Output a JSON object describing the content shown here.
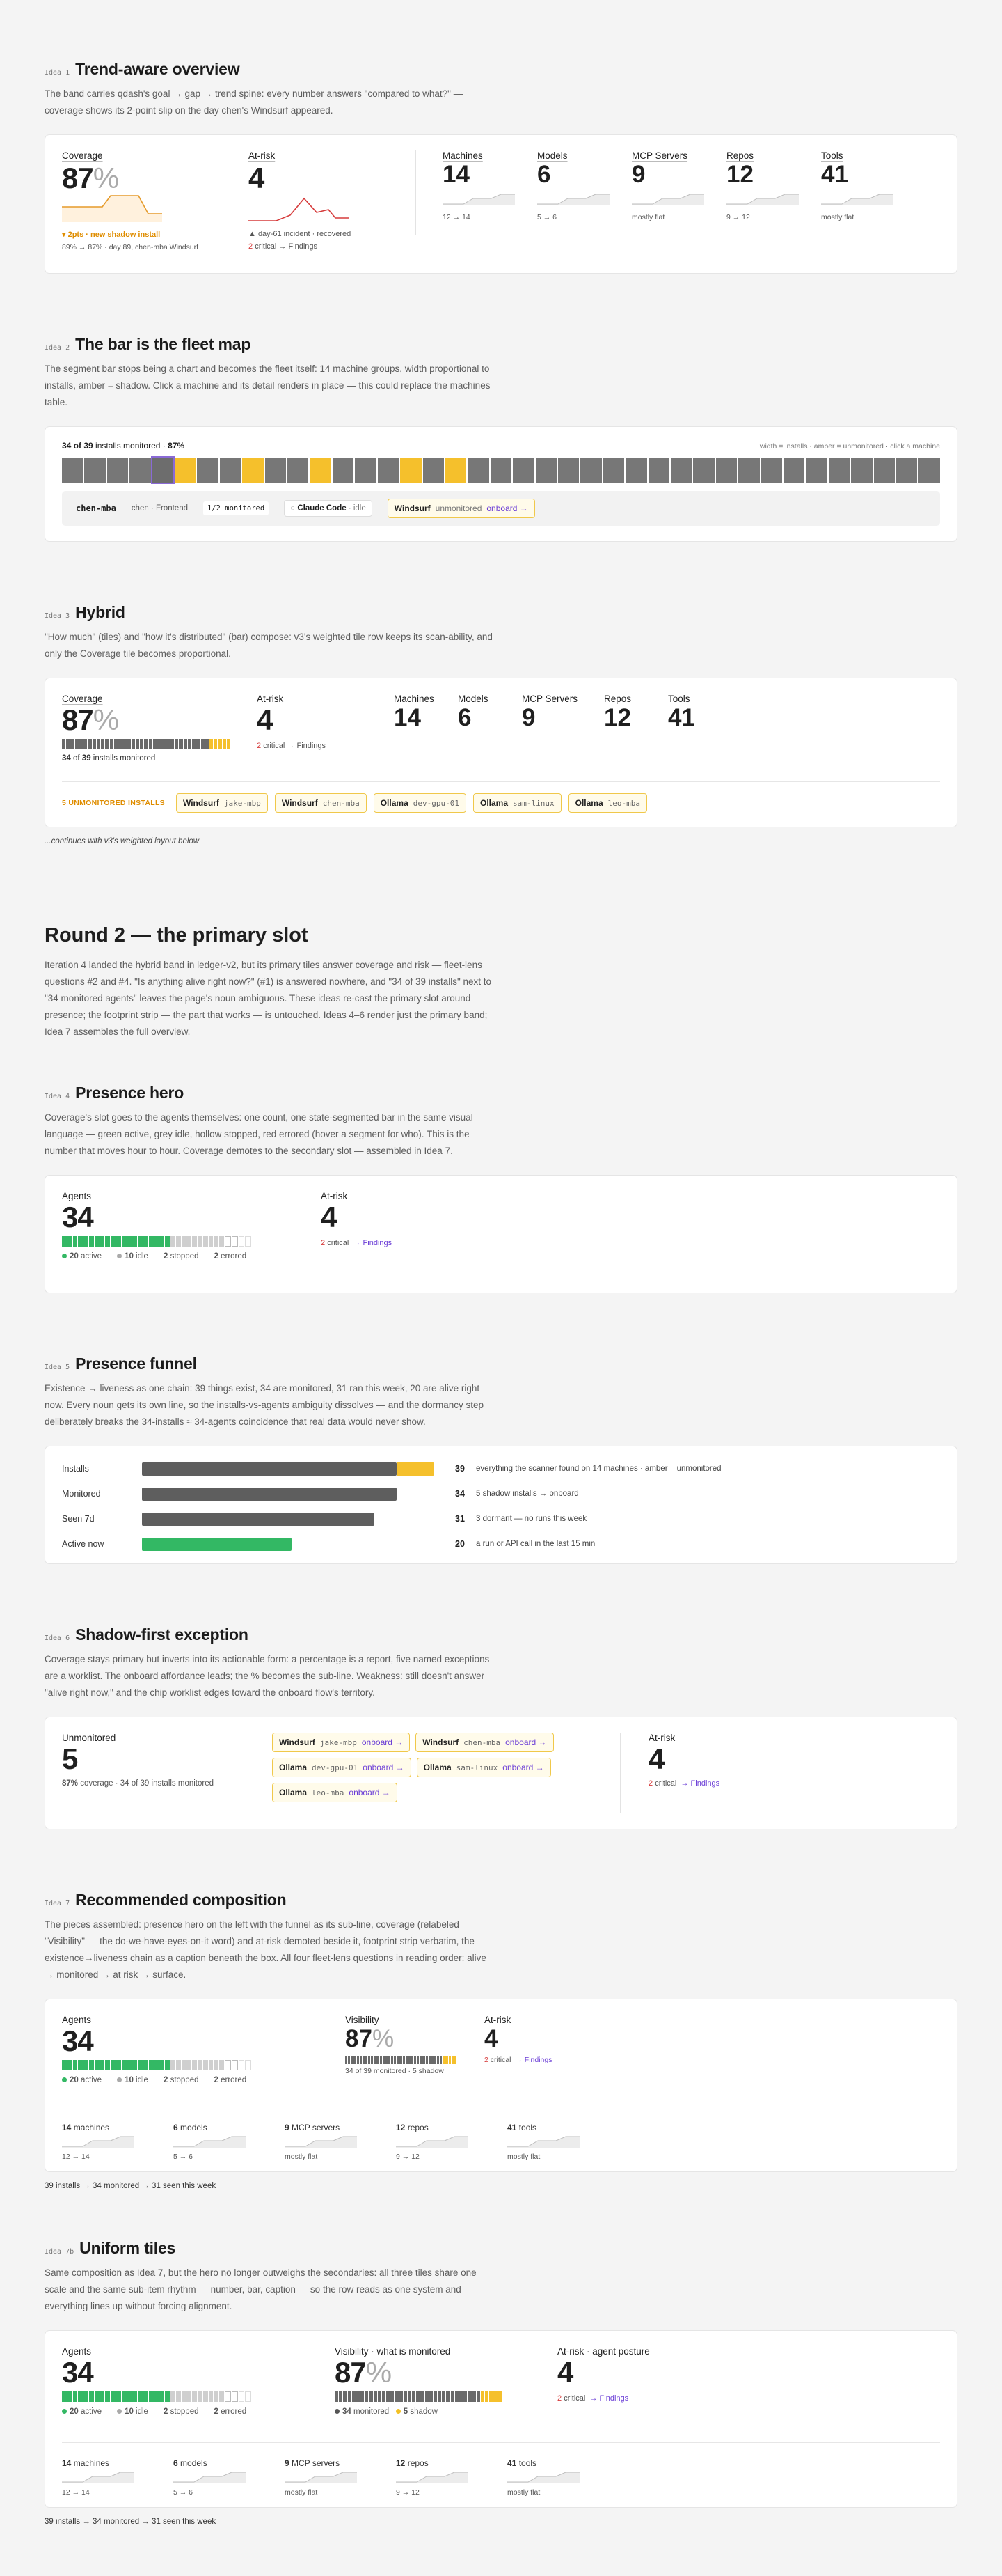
{
  "idea1": {
    "tag": "Idea 1",
    "title": "Trend-aware overview",
    "desc": "The band carries qdash's goal → gap → trend spine: every number answers \"compared to what?\" — coverage shows its 2-point slip on the day chen's Windsurf appeared.",
    "coverage": {
      "label": "Coverage",
      "value": "87",
      "pct": "%",
      "note": "▾ 2pts · new shadow install",
      "sub": "89% → 87% · day 89, chen-mba Windsurf",
      "series": [
        89,
        89,
        89,
        89,
        89,
        89,
        89,
        87,
        87
      ]
    },
    "atrisk": {
      "label": "At-risk",
      "value": "4",
      "note": "▲ day-61 incident · recovered",
      "sub_count": "2",
      "sub_text": "critical → Findings",
      "series": [
        1,
        1,
        1,
        1,
        4,
        3,
        2,
        1,
        1,
        1,
        2
      ]
    },
    "tiles": [
      {
        "label": "Machines",
        "value": "14",
        "sub": "12 → 14"
      },
      {
        "label": "Models",
        "value": "6",
        "sub": "5 → 6"
      },
      {
        "label": "MCP Servers",
        "value": "9",
        "sub": "mostly flat"
      },
      {
        "label": "Repos",
        "value": "12",
        "sub": "9 → 12"
      },
      {
        "label": "Tools",
        "value": "41",
        "sub": "mostly flat"
      }
    ]
  },
  "idea2": {
    "tag": "Idea 2",
    "title": "The bar is the fleet map",
    "desc": "The segment bar stops being a chart and becomes the fleet itself: 14 machine groups, width proportional to installs, amber = shadow. Click a machine and its detail renders in place — this could replace the machines table.",
    "count_bold": "34 of 39",
    "count_rest": "installs monitored ·",
    "count_pct": "87%",
    "hint": "width = installs · amber = unmonitored · click a machine",
    "detail": {
      "machine": "chen-mba",
      "owner": "chen · Frontend",
      "monitored": "1/2 monitored",
      "tool1": "Claude Code",
      "tool1_state": "· idle",
      "tool2": "Windsurf",
      "tool2_state": "unmonitored",
      "onboard": "onboard →"
    },
    "segments": [
      "g",
      "g",
      "g",
      "g",
      "sel",
      "a",
      "g",
      "g",
      "a",
      "g",
      "g",
      "a",
      "g",
      "g",
      "g",
      "a",
      "g",
      "a",
      "g",
      "g",
      "g",
      "g",
      "g",
      "g",
      "g",
      "g",
      "g",
      "g",
      "g",
      "g",
      "g",
      "g",
      "g",
      "g",
      "g",
      "g",
      "g",
      "g",
      "g"
    ]
  },
  "idea3": {
    "tag": "Idea 3",
    "title": "Hybrid",
    "desc": "\"How much\" (tiles) and \"how it's distributed\" (bar) compose: v3's weighted tile row keeps its scan-ability, and only the Coverage tile becomes proportional.",
    "coverage": {
      "label": "Coverage",
      "value": "87",
      "pct": "%",
      "sub_bold": "34",
      "sub_rest": "of",
      "sub_bold2": "39",
      "sub_tail": "installs monitored",
      "segments": [
        "g",
        "g",
        "g",
        "g",
        "g",
        "g",
        "g",
        "g",
        "g",
        "g",
        "g",
        "g",
        "g",
        "g",
        "g",
        "g",
        "g",
        "g",
        "g",
        "g",
        "g",
        "g",
        "g",
        "g",
        "g",
        "g",
        "g",
        "g",
        "g",
        "g",
        "g",
        "g",
        "g",
        "g",
        "a",
        "a",
        "a",
        "a",
        "a"
      ]
    },
    "atrisk": {
      "label": "At-risk",
      "value": "4",
      "sub_count": "2",
      "sub_text": "critical → Findings"
    },
    "tiles": [
      {
        "label": "Machines",
        "value": "14"
      },
      {
        "label": "Models",
        "value": "6"
      },
      {
        "label": "MCP Servers",
        "value": "9"
      },
      {
        "label": "Repos",
        "value": "12"
      },
      {
        "label": "Tools",
        "value": "41"
      }
    ],
    "unmon_label": "5 UNMONITORED INSTALLS",
    "chips": [
      {
        "tool": "Windsurf",
        "host": "jake-mbp"
      },
      {
        "tool": "Windsurf",
        "host": "chen-mba"
      },
      {
        "tool": "Ollama",
        "host": "dev-gpu-01"
      },
      {
        "tool": "Ollama",
        "host": "sam-linux"
      },
      {
        "tool": "Ollama",
        "host": "leo-mba"
      }
    ],
    "continues": "...continues with v3's weighted layout below"
  },
  "round2": {
    "title": "Round 2 — the primary slot",
    "desc": "Iteration 4 landed the hybrid band in ledger-v2, but its primary tiles answer coverage and risk — fleet-lens questions #2 and #4. \"Is anything alive right now?\" (#1) is answered nowhere, and \"34 of 39 installs\" next to \"34 monitored agents\" leaves the page's noun ambiguous. These ideas re-cast the primary slot around presence; the footprint strip — the part that works — is untouched. Ideas 4–6 render just the primary band; Idea 7 assembles the full overview."
  },
  "idea4": {
    "tag": "Idea 4",
    "title": "Presence hero",
    "desc": "Coverage's slot goes to the agents themselves: one count, one state-segmented bar in the same visual language — green active, grey idle, hollow stopped, red errored (hover a segment for who). This is the number that moves hour to hour. Coverage demotes to the secondary slot — assembled in Idea 7.",
    "agents": {
      "label": "Agents",
      "value": "34",
      "active": "20",
      "active_l": "active",
      "idle": "10",
      "idle_l": "idle",
      "stopped": "2",
      "stopped_l": "stopped",
      "errored": "2",
      "errored_l": "errored"
    },
    "atrisk": {
      "label": "At-risk",
      "value": "4",
      "sub_count": "2",
      "sub_text": "critical",
      "link": "→ Findings"
    }
  },
  "idea5": {
    "tag": "Idea 5",
    "title": "Presence funnel",
    "desc": "Existence → liveness as one chain: 39 things exist, 34 are monitored, 31 ran this week, 20 are alive right now. Every noun gets its own line, so the installs-vs-agents ambiguity dissolves — and the dormancy step deliberately breaks the 34-installs ≈ 34-agents coincidence that real data would never show.",
    "rows": [
      {
        "label": "Installs",
        "value": "39",
        "note": "everything the scanner found on 14 machines · amber = unmonitored",
        "n": 39,
        "shadow": 5,
        "color": "#5e5e5e"
      },
      {
        "label": "Monitored",
        "value": "34",
        "note": "5 shadow installs → onboard",
        "n": 34,
        "shadow": 0,
        "color": "#5e5e5e"
      },
      {
        "label": "Seen 7d",
        "value": "31",
        "note": "3 dormant — no runs this week",
        "n": 31,
        "shadow": 0,
        "color": "#5e5e5e"
      },
      {
        "label": "Active now",
        "value": "20",
        "note": "a run or API call in the last 15 min",
        "n": 20,
        "shadow": 0,
        "color": "#33b864"
      }
    ]
  },
  "idea6": {
    "tag": "Idea 6",
    "title": "Shadow-first exception",
    "desc": "Coverage stays primary but inverts into its actionable form: a percentage is a report, five named exceptions are a worklist. The onboard affordance leads; the % becomes the sub-line. Weakness: still doesn't answer \"alive right now,\" and the chip worklist edges toward the onboard flow's territory.",
    "unmon": {
      "label": "Unmonitored",
      "value": "5",
      "sub_bold": "87%",
      "sub_rest": "coverage · 34 of 39 installs monitored"
    },
    "chips": [
      {
        "tool": "Windsurf",
        "host": "jake-mbp",
        "ob": "onboard →"
      },
      {
        "tool": "Windsurf",
        "host": "chen-mba",
        "ob": "onboard →"
      },
      {
        "tool": "Ollama",
        "host": "dev-gpu-01",
        "ob": "onboard →"
      },
      {
        "tool": "Ollama",
        "host": "sam-linux",
        "ob": "onboard →"
      },
      {
        "tool": "Ollama",
        "host": "leo-mba",
        "ob": "onboard →"
      }
    ],
    "atrisk": {
      "label": "At-risk",
      "value": "4",
      "sub_count": "2",
      "sub_text": "critical",
      "link": "→ Findings"
    }
  },
  "idea7": {
    "tag": "Idea 7",
    "title": "Recommended composition",
    "desc": "The pieces assembled: presence hero on the left with the funnel as its sub-line, coverage (relabeled \"Visibility\" — the do-we-have-eyes-on-it word) and at-risk demoted beside it, footprint strip verbatim, the existence→liveness chain as a caption beneath the box. All four fleet-lens questions in reading order: alive → monitored → at risk → surface.",
    "agents": {
      "label": "Agents",
      "value": "34",
      "active": "20",
      "active_l": "active",
      "idle": "10",
      "idle_l": "idle",
      "stopped": "2",
      "stopped_l": "stopped",
      "errored": "2",
      "errored_l": "errored"
    },
    "vis": {
      "label": "Visibility",
      "value": "87",
      "pct": "%",
      "sub": "34 of 39 monitored · 5 shadow"
    },
    "atrisk": {
      "label": "At-risk",
      "value": "4",
      "sub_count": "2",
      "sub_text": "critical",
      "link": "→ Findings"
    },
    "strip": [
      {
        "n": "14",
        "l": "machines",
        "s": "12 → 14"
      },
      {
        "n": "6",
        "l": "models",
        "s": "5 → 6"
      },
      {
        "n": "9",
        "l": "MCP servers",
        "s": "mostly flat"
      },
      {
        "n": "12",
        "l": "repos",
        "s": "9 → 12"
      },
      {
        "n": "41",
        "l": "tools",
        "s": "mostly flat"
      }
    ],
    "caption": "39 installs → 34 monitored → 31 seen this week"
  },
  "idea7b": {
    "tag": "Idea 7b",
    "title": "Uniform tiles",
    "desc": "Same composition as Idea 7, but the hero no longer outweighs the secondaries: all three tiles share one scale and the same sub-item rhythm — number, bar, caption — so the row reads as one system and everything lines up without forcing alignment.",
    "agents": {
      "label": "Agents",
      "value": "34",
      "active": "20",
      "active_l": "active",
      "idle": "10",
      "idle_l": "idle",
      "stopped": "2",
      "stopped_l": "stopped",
      "errored": "2",
      "errored_l": "errored"
    },
    "vis": {
      "label": "Visibility · what is monitored",
      "value": "87",
      "pct": "%",
      "mon": "34",
      "mon_l": "monitored",
      "sh": "5",
      "sh_l": "shadow"
    },
    "atrisk": {
      "label": "At-risk · agent posture",
      "value": "4",
      "sub_count": "2",
      "sub_text": "critical",
      "link": "→ Findings"
    },
    "strip": [
      {
        "n": "14",
        "l": "machines",
        "s": "12 → 14"
      },
      {
        "n": "6",
        "l": "models",
        "s": "5 → 6"
      },
      {
        "n": "9",
        "l": "MCP servers",
        "s": "mostly flat"
      },
      {
        "n": "12",
        "l": "repos",
        "s": "9 → 12"
      },
      {
        "n": "41",
        "l": "tools",
        "s": "mostly flat"
      }
    ],
    "caption": "39 installs → 34 monitored → 31 seen this week"
  }
}
